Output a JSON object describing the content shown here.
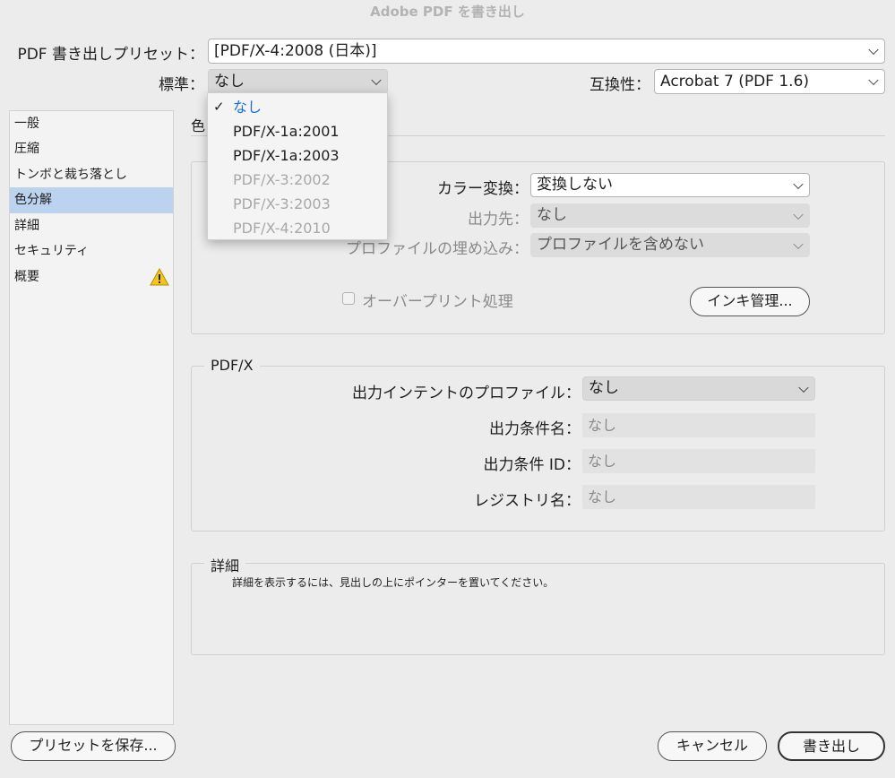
{
  "window": {
    "title": "Adobe PDF を書き出し"
  },
  "preset": {
    "label": "PDF 書き出しプリセット：",
    "value": "[PDF/X-4:2008 (日本)]"
  },
  "standard": {
    "label": "標準：",
    "value": "なし",
    "menu": [
      {
        "label": "なし",
        "state": "selected"
      },
      {
        "label": "PDF/X-1a:2001",
        "state": "enabled"
      },
      {
        "label": "PDF/X-1a:2003",
        "state": "enabled"
      },
      {
        "label": "PDF/X-3:2002",
        "state": "disabled"
      },
      {
        "label": "PDF/X-3:2003",
        "state": "disabled"
      },
      {
        "label": "PDF/X-4:2010",
        "state": "disabled"
      }
    ]
  },
  "compat": {
    "label": "互換性：",
    "value": "Acrobat 7 (PDF 1.6)"
  },
  "sidebar": {
    "items": [
      {
        "label": "一般"
      },
      {
        "label": "圧縮"
      },
      {
        "label": "トンボと裁ち落とし"
      },
      {
        "label": "色分解",
        "selected": true
      },
      {
        "label": "詳細"
      },
      {
        "label": "セキュリティ"
      },
      {
        "label": "概要",
        "warning": true
      }
    ]
  },
  "section": {
    "title": "色"
  },
  "color_panel": {
    "conversion": {
      "label": "カラー変換：",
      "value": "変換しない"
    },
    "destination": {
      "label": "出力先：",
      "value": "なし"
    },
    "profile": {
      "label": "プロファイルの埋め込み：",
      "value": "プロファイルを含めない"
    },
    "overprint_label": "オーバープリント処理",
    "ink_button": "インキ管理..."
  },
  "pdfx": {
    "title": "PDF/X",
    "intent": {
      "label": "出力インテントのプロファイル：",
      "value": "なし"
    },
    "condition_name": {
      "label": "出力条件名：",
      "value": "なし"
    },
    "condition_id": {
      "label": "出力条件 ID：",
      "value": "なし"
    },
    "registry": {
      "label": "レジストリ名：",
      "value": "なし"
    }
  },
  "detail": {
    "title": "詳細",
    "text": "詳細を表示するには、見出しの上にポインターを置いてください。"
  },
  "buttons": {
    "save_preset": "プリセットを保存...",
    "cancel": "キャンセル",
    "export": "書き出し"
  },
  "colors": {
    "selection": "#bcd3ef",
    "menu_selected": "#1670d8",
    "warning": "#f5c518"
  },
  "icons": {
    "check": "✓"
  }
}
